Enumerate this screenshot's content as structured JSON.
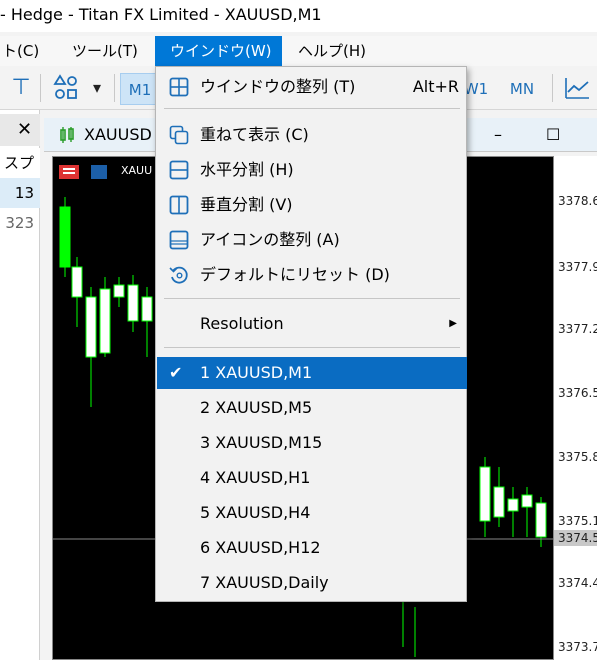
{
  "window_title": "- Hedge - Titan FX Limited - XAUUSD,M1",
  "menubar": {
    "items": [
      {
        "label": "ト(C)"
      },
      {
        "label": "ツール(T)"
      },
      {
        "label": "ウインドウ(W)"
      },
      {
        "label": "ヘルプ(H)"
      }
    ]
  },
  "toolbar": {
    "timeframes": [
      "M1",
      "W1",
      "MN"
    ]
  },
  "left_panel": {
    "header_partial": "スプ",
    "rows": [
      "13",
      "323"
    ]
  },
  "chart_window": {
    "title": "XAUUSD",
    "mini_label": "XAUU",
    "price_axis": [
      {
        "label": "3378.6"
      },
      {
        "label": "3377.9"
      },
      {
        "label": "3377.2"
      },
      {
        "label": "3376.5"
      },
      {
        "label": "3375.8"
      },
      {
        "label": "3375.1"
      },
      {
        "label": "3374.4"
      },
      {
        "label": "3373.7"
      }
    ],
    "current_price": "3374.5"
  },
  "dropdown": {
    "items": [
      {
        "label": "ウインドウの整列 (T)",
        "accel": "Alt+R",
        "icon": "tile-windows-icon"
      },
      {
        "label": "重ねて表示 (C)",
        "icon": "cascade-icon"
      },
      {
        "label": "水平分割 (H)",
        "icon": "tile-horizontal-icon"
      },
      {
        "label": "垂直分割 (V)",
        "icon": "tile-vertical-icon"
      },
      {
        "label": "アイコンの整列 (A)",
        "icon": "arrange-icons-icon"
      },
      {
        "label": "デフォルトにリセット (D)",
        "icon": "reset-icon"
      },
      {
        "label": "Resolution"
      }
    ],
    "windows": [
      {
        "label": "1 XAUUSD,M1",
        "checked": true
      },
      {
        "label": "2 XAUUSD,M5"
      },
      {
        "label": "3 XAUUSD,M15"
      },
      {
        "label": "4 XAUUSD,H1"
      },
      {
        "label": "5 XAUUSD,H4"
      },
      {
        "label": "6 XAUUSD,H12"
      },
      {
        "label": "7 XAUUSD,Daily"
      }
    ]
  },
  "colors": {
    "accent": "#0078d7",
    "selection": "#0a6cc2",
    "icon_blue": "#1e6fb8",
    "bull_candle": "#00ff00"
  }
}
